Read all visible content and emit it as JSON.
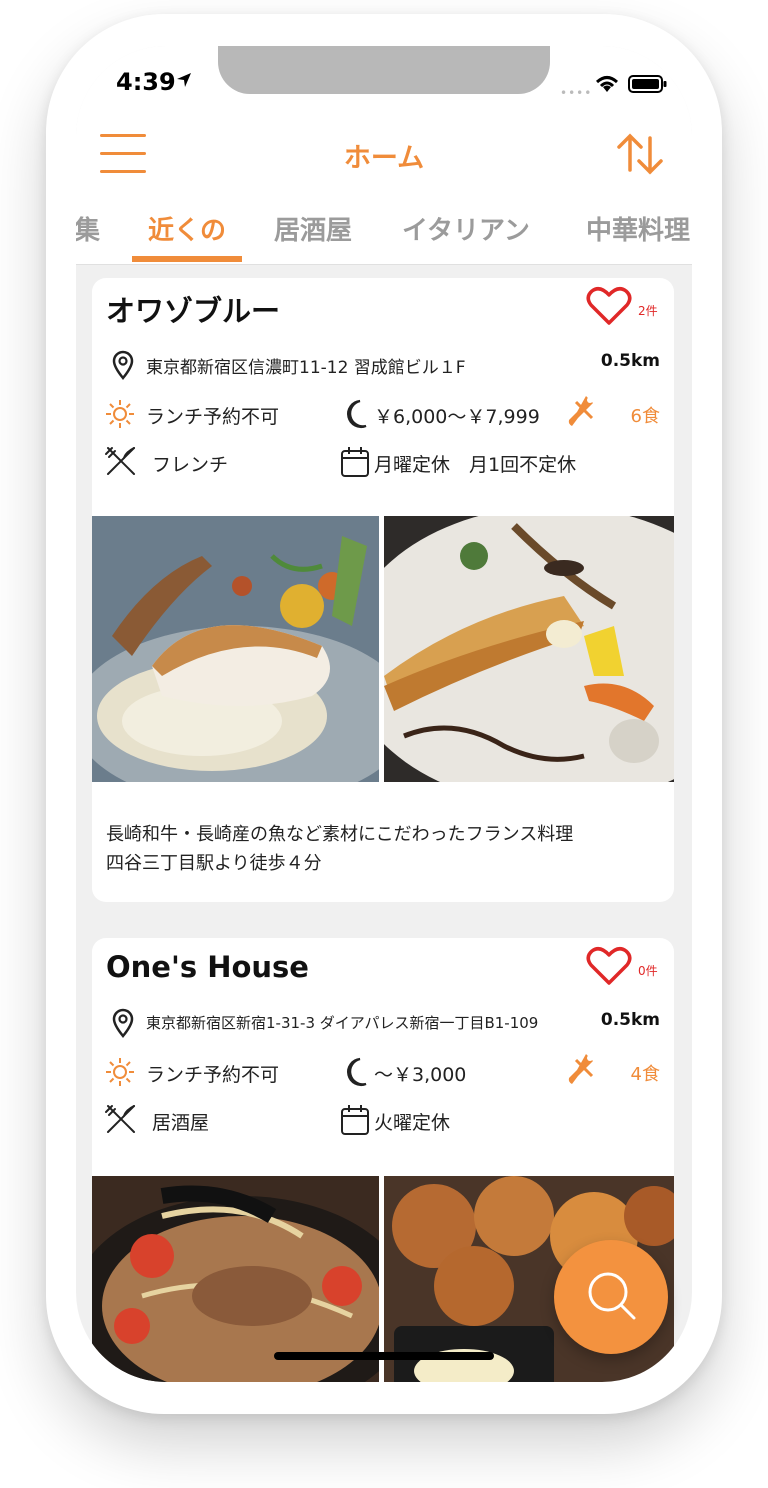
{
  "status": {
    "time": "4:39"
  },
  "header": {
    "title": "ホーム"
  },
  "tabs": [
    "集",
    "近くの",
    "居酒屋",
    "イタリアン",
    "中華料理"
  ],
  "restaurants": [
    {
      "name": "オワゾブルー",
      "likes": "2件",
      "address": "東京都新宿区信濃町11-12 習成館ビル１F",
      "distance": "0.5km",
      "lunch": "ランチ予約不可",
      "price": "￥6,000〜￥7,999",
      "meals": "6食",
      "genre": "フレンチ",
      "holiday": "月曜定休　月1回不定休",
      "description_line1": "長崎和牛・長崎産の魚など素材にこだわったフランス料理",
      "description_line2": "四谷三丁目駅より徒歩４分"
    },
    {
      "name": "One's House",
      "likes": "0件",
      "address": "東京都新宿区新宿1-31-3 ダイアパレス新宿一丁目B1-109",
      "distance": "0.5km",
      "lunch": "ランチ予約不可",
      "price": "〜￥3,000",
      "meals": "4食",
      "genre": "居酒屋",
      "holiday": "火曜定休"
    }
  ],
  "colors": {
    "accent": "#f08c3a",
    "heart": "#e02828"
  },
  "icons": [
    "menu-icon",
    "sort-icon",
    "location-pin-icon",
    "sun-icon",
    "moon-icon",
    "tool-icon",
    "fork-knife-icon",
    "calendar-icon",
    "heart-icon",
    "search-icon"
  ]
}
